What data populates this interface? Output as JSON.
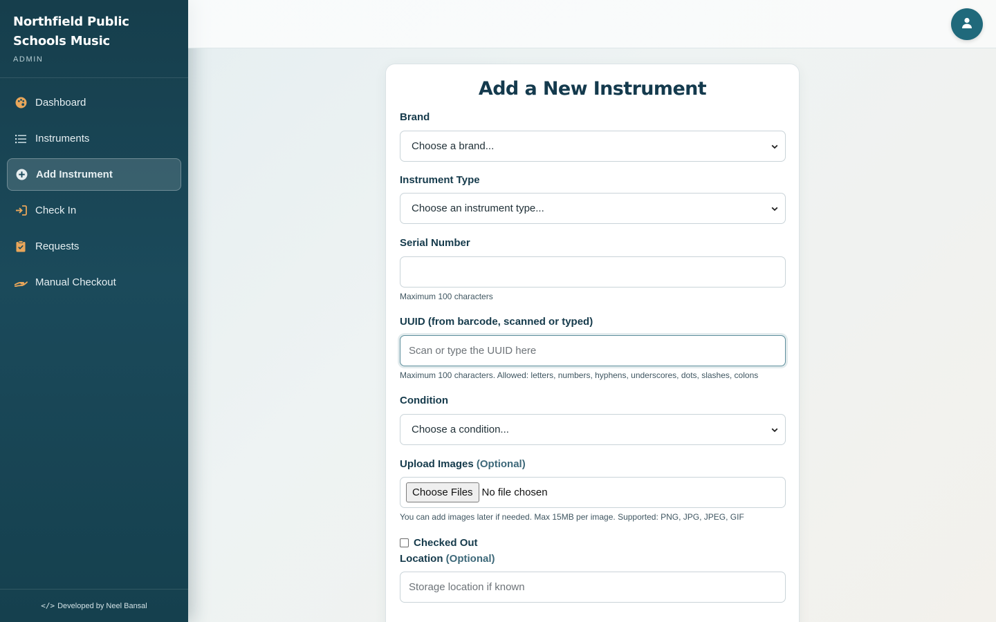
{
  "sidebar": {
    "brand_title": "Northfield Public Schools Music",
    "brand_sub": "ADMIN",
    "items": [
      {
        "label": "Dashboard",
        "icon": "palette-icon"
      },
      {
        "label": "Instruments",
        "icon": "list-icon"
      },
      {
        "label": "Add Instrument",
        "icon": "plus-circle-icon",
        "active": true
      },
      {
        "label": "Check In",
        "icon": "sign-in-icon"
      },
      {
        "label": "Requests",
        "icon": "clipboard-check-icon"
      },
      {
        "label": "Manual Checkout",
        "icon": "hand-holding-icon"
      }
    ],
    "footer": "Developed by Neel Bansal"
  },
  "topbar": {
    "avatar_icon": "user-icon"
  },
  "form": {
    "title": "Add a New Instrument",
    "brand": {
      "label": "Brand",
      "selected": "Choose a brand..."
    },
    "instrument_type": {
      "label": "Instrument Type",
      "selected": "Choose an instrument type..."
    },
    "serial_number": {
      "label": "Serial Number",
      "value": "",
      "hint": "Maximum 100 characters"
    },
    "uuid": {
      "label": "UUID (from barcode, scanned or typed)",
      "placeholder": "Scan or type the UUID here",
      "hint": "Maximum 100 characters. Allowed: letters, numbers, hyphens, underscores, dots, slashes, colons"
    },
    "condition": {
      "label": "Condition",
      "selected": "Choose a condition..."
    },
    "upload": {
      "label": "Upload Images",
      "optional": "(Optional)",
      "button": "Choose Files",
      "status": "No file chosen",
      "hint": "You can add images later if needed. Max 15MB per image. Supported: PNG, JPG, JPEG, GIF"
    },
    "checked_out": {
      "label": "Checked Out",
      "checked": false
    },
    "location": {
      "label": "Location",
      "optional": "(Optional)",
      "placeholder": "Storage location if known"
    }
  },
  "colors": {
    "sidebar": "#1b4a5b",
    "accent": "#20697b",
    "heading": "#143a4d"
  }
}
